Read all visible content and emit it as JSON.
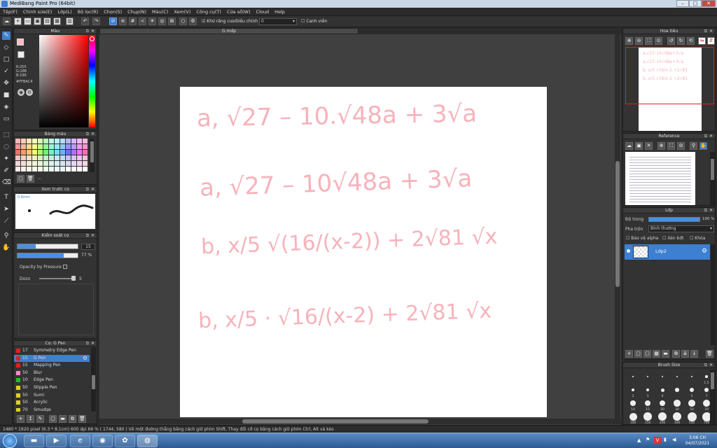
{
  "window": {
    "title": "MediBang Paint Pro (64bit)",
    "min": "–",
    "max": "□",
    "close": "✕"
  },
  "menu": [
    "Tệp(F)",
    "Chỉnh sửa(E)",
    "Lớp(L)",
    "Bộ lọc(R)",
    "Chọn(S)",
    "Chụp(N)",
    "Màu(C)",
    "Xem(V)",
    "Công cụ(T)",
    "Cửa sổ(W)",
    "Cloud",
    "Help"
  ],
  "toolbar": {
    "antialias_label": "Khử răng cưa",
    "adjust_label": "Điều chỉnh",
    "adjust_value": "0",
    "snap_label": "Canh viền"
  },
  "document": {
    "tab": "G.mdp"
  },
  "color_panel": {
    "title": "Màu",
    "r": "R:255",
    "g": "G:186",
    "b": "B:196",
    "hex": "#FFBAC4",
    "primary": "#FFBAC4",
    "hue_marker": "#FF0000"
  },
  "palette_panel": {
    "title": "Bảng màu",
    "more": "..."
  },
  "preview_panel": {
    "title": "Xem trước cọ",
    "size": "0.6mm"
  },
  "brush_control": {
    "title": "Kiểm soát cọ",
    "size_value": "15",
    "opacity_value": "77 %",
    "opacity_pressure": "Opacity by Pressure",
    "density_label": "Dozo",
    "density_value": "5"
  },
  "brush_list": {
    "title": "Cọ: G Pen",
    "items": [
      {
        "num": "17",
        "name": "Symmetry Edge Pen",
        "color": "#e02020"
      },
      {
        "num": "15",
        "name": "G Pen",
        "color": "#e02020"
      },
      {
        "num": "15",
        "name": "Mapping Pen",
        "color": "#e02020"
      },
      {
        "num": "50",
        "name": "Blur",
        "color": "#ff88cc"
      },
      {
        "num": "10",
        "name": "Edge Pen",
        "color": "#20c020"
      },
      {
        "num": "50",
        "name": "Stipple Pen",
        "color": "#e0d020"
      },
      {
        "num": "50",
        "name": "Sumi",
        "color": "#e0d020"
      },
      {
        "num": "50",
        "name": "Acrylic",
        "color": "#e0d020"
      },
      {
        "num": "70",
        "name": "Smudge",
        "color": "#e0d020"
      }
    ]
  },
  "navigator": {
    "title": "Hoa tiêu"
  },
  "reference": {
    "title": "Reference"
  },
  "layer_panel": {
    "title": "Lớp",
    "opacity_label": "Độ trong",
    "opacity_value": "100 %",
    "blend_label": "Pha trộn",
    "blend_value": "Bình thường",
    "protect_alpha": "Bảo vệ alpha",
    "clipping": "Xén bớt",
    "lock": "Khóa",
    "layer_name": "Lớp2"
  },
  "brush_size": {
    "title": "Brush Size",
    "labels": [
      "",
      "",
      "",
      "",
      "",
      "1.5",
      "2",
      "3",
      "4",
      "",
      "5",
      "7",
      "10",
      "15",
      "20",
      "30",
      "50",
      "70",
      "100",
      "150",
      "200",
      "300",
      "500",
      "700"
    ]
  },
  "handwriting": [
    {
      "text": "a, √27 – 10.√48a + 3√a"
    },
    {
      "text": "a, √27 – 10√48a + 3√a"
    },
    {
      "text": "b, x/5 √(16/(x-2)) + 2√81 √x"
    },
    {
      "text": "b, x/5 · √16/(x-2) + 2√81 √x"
    }
  ],
  "status": {
    "text": "1480 * 1920 pixel  (6.3 * 8.1cm)  600 dpi  66 %  ( 1744, 580 )  Vẽ một đường thẳng bằng cách giữ phím Shift, Thay đổi cỡ cọ bằng cách giữ phím Ctrl, Alt và kéo"
  },
  "clock": {
    "time": "3:06 CH",
    "date": "04/07/2021"
  },
  "tray": {
    "lang": "V"
  }
}
